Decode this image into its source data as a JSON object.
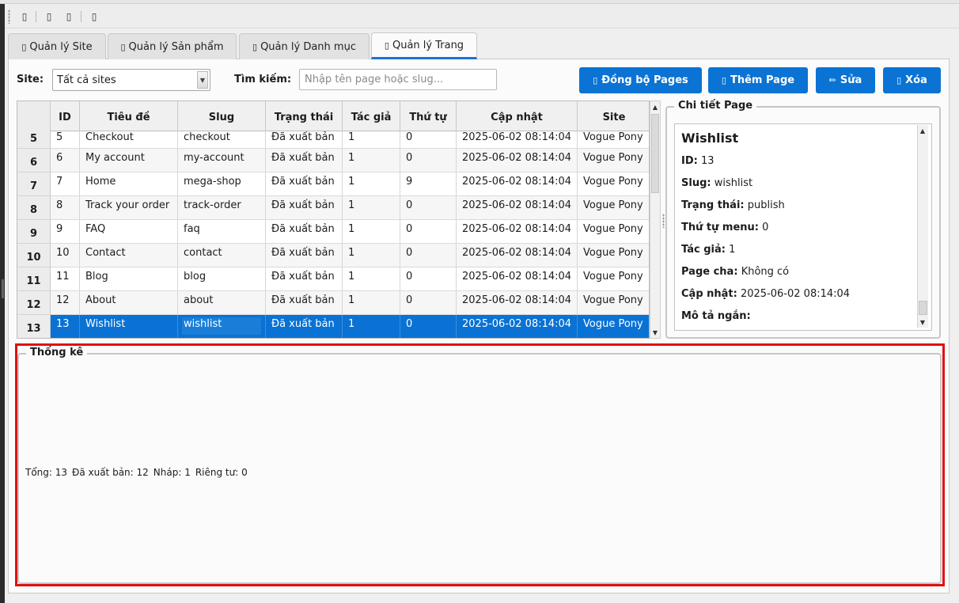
{
  "toolbar": {
    "buttons": [
      {
        "icon": "document-icon",
        "glyph": "▯"
      },
      {
        "icon": "document-icon",
        "glyph": "▯"
      },
      {
        "icon": "document-icon",
        "glyph": "▯"
      },
      {
        "icon": "document-icon",
        "glyph": "▯"
      }
    ]
  },
  "tabs": [
    {
      "icon": "▯",
      "label": "Quản lý Site"
    },
    {
      "icon": "▯",
      "label": "Quản lý Sản phẩm"
    },
    {
      "icon": "▯",
      "label": "Quản lý Danh mục"
    },
    {
      "icon": "▯",
      "label": "Quản lý Trang",
      "active": true
    }
  ],
  "filters": {
    "site_label": "Site:",
    "site_value": "Tất cả sites",
    "search_label": "Tìm kiếm:",
    "search_placeholder": "Nhập tên page hoặc slug...",
    "search_value": ""
  },
  "actions": {
    "sync": {
      "icon": "▯",
      "label": "Đồng bộ Pages"
    },
    "add": {
      "icon": "▯",
      "label": "Thêm Page"
    },
    "edit": {
      "icon": "✏",
      "label": "Sửa"
    },
    "delete": {
      "icon": "▯",
      "label": "Xóa"
    }
  },
  "table": {
    "columns": [
      "ID",
      "Tiêu đề",
      "Slug",
      "Trạng thái",
      "Tác giả",
      "Thứ tự",
      "Cập nhật",
      "Site"
    ],
    "rows": [
      {
        "num": "5",
        "cells": [
          "5",
          "Checkout",
          "checkout",
          "Đã xuất bản",
          "1",
          "0",
          "2025-06-02 08:14:04",
          "Vogue Pony"
        ]
      },
      {
        "num": "6",
        "cells": [
          "6",
          "My account",
          "my-account",
          "Đã xuất bản",
          "1",
          "0",
          "2025-06-02 08:14:04",
          "Vogue Pony"
        ]
      },
      {
        "num": "7",
        "cells": [
          "7",
          "Home",
          "mega-shop",
          "Đã xuất bản",
          "1",
          "9",
          "2025-06-02 08:14:04",
          "Vogue Pony"
        ]
      },
      {
        "num": "8",
        "cells": [
          "8",
          "Track your order",
          "track-order",
          "Đã xuất bản",
          "1",
          "0",
          "2025-06-02 08:14:04",
          "Vogue Pony"
        ]
      },
      {
        "num": "9",
        "cells": [
          "9",
          "FAQ",
          "faq",
          "Đã xuất bản",
          "1",
          "0",
          "2025-06-02 08:14:04",
          "Vogue Pony"
        ]
      },
      {
        "num": "10",
        "cells": [
          "10",
          "Contact",
          "contact",
          "Đã xuất bản",
          "1",
          "0",
          "2025-06-02 08:14:04",
          "Vogue Pony"
        ]
      },
      {
        "num": "11",
        "cells": [
          "11",
          "Blog",
          "blog",
          "Đã xuất bản",
          "1",
          "0",
          "2025-06-02 08:14:04",
          "Vogue Pony"
        ]
      },
      {
        "num": "12",
        "cells": [
          "12",
          "About",
          "about",
          "Đã xuất bản",
          "1",
          "0",
          "2025-06-02 08:14:04",
          "Vogue Pony"
        ]
      },
      {
        "num": "13",
        "cells": [
          "13",
          "Wishlist",
          "wishlist",
          "Đã xuất bản",
          "1",
          "0",
          "2025-06-02 08:14:04",
          "Vogue Pony"
        ],
        "selected": true
      }
    ]
  },
  "detail": {
    "group_title": "Chi tiết Page",
    "title": "Wishlist",
    "fields": [
      {
        "label": "ID:",
        "value": "13"
      },
      {
        "label": "Slug:",
        "value": "wishlist"
      },
      {
        "label": "Trạng thái:",
        "value": "publish"
      },
      {
        "label": "Thứ tự menu:",
        "value": "0"
      },
      {
        "label": "Tác giả:",
        "value": "1"
      },
      {
        "label": "Page cha:",
        "value": "Không có"
      },
      {
        "label": "Cập nhật:",
        "value": "2025-06-02 08:14:04"
      },
      {
        "label": "Mô tả ngắn:",
        "value": ""
      }
    ]
  },
  "stats": {
    "group_title": "Thống kê",
    "total": "Tổng: 13",
    "published": "Đã xuất bản: 12",
    "draft": "Nháp: 1",
    "private": "Riêng tư: 0"
  }
}
